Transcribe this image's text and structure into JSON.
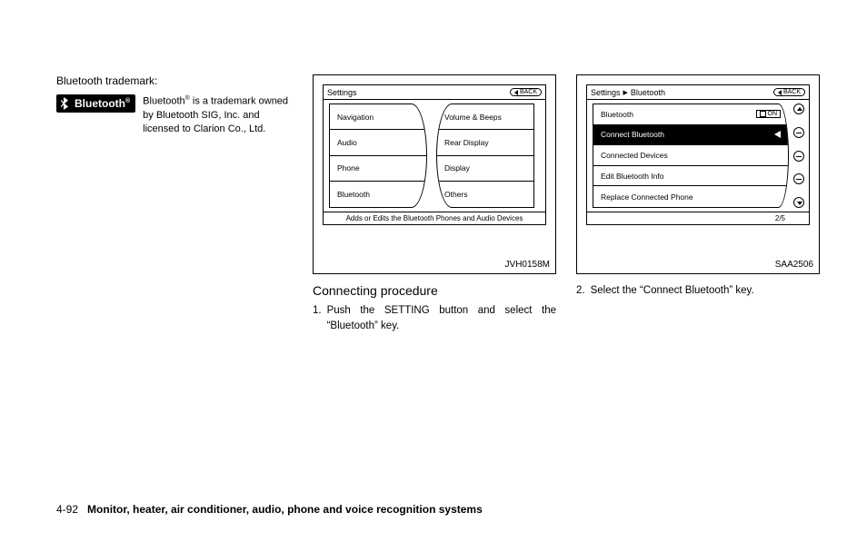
{
  "col1": {
    "heading": "Bluetooth trademark:",
    "logo_text": "Bluetooth",
    "logo_sup": "®",
    "body_pre": "Bluetooth",
    "body_sup": "®",
    "body_post": " is a trademark owned by Bluetooth SIG, Inc. and licensed to Clarion Co., Ltd."
  },
  "fig1": {
    "crumb1": "Settings",
    "back": "BACK",
    "left": [
      "Navigation",
      "Audio",
      "Phone",
      "Bluetooth"
    ],
    "right": [
      "Volume & Beeps",
      "Rear Display",
      "Display",
      "Others"
    ],
    "footer": "Adds or Edits the Bluetooth Phones and Audio Devices",
    "id": "JVH0158M"
  },
  "fig2": {
    "crumb1": "Settings",
    "crumb2": "Bluetooth",
    "back": "BACK",
    "rows": [
      "Bluetooth",
      "Connect Bluetooth",
      "Connected Devices",
      "Edit Bluetooth Info",
      "Replace Connected Phone"
    ],
    "on": "ON",
    "footer": "2/5",
    "id": "SAA2506"
  },
  "col2": {
    "subheading": "Connecting procedure",
    "step1_num": "1.",
    "step1_txt": "Push the SETTING button and select the “Bluetooth” key."
  },
  "col3": {
    "step2_num": "2.",
    "step2_txt": "Select the “Connect Bluetooth” key."
  },
  "footer": {
    "page": "4-92",
    "title": "Monitor, heater, air conditioner, audio, phone and voice recognition systems"
  }
}
